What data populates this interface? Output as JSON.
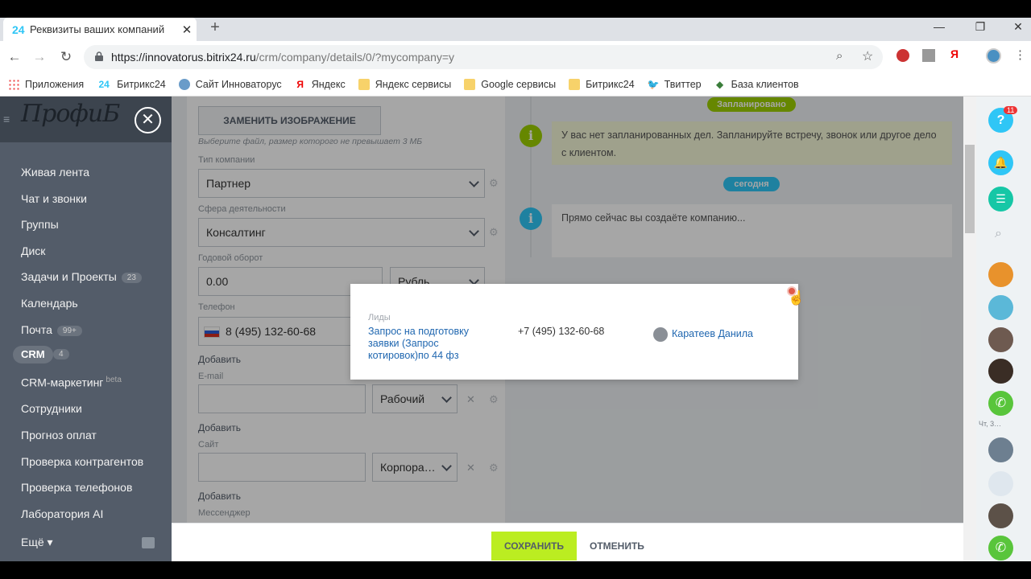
{
  "browser": {
    "tab_title": "Реквизиты ваших компаний",
    "tab_favicon": "24",
    "url_host": "https://innovatorus.bitrix24.ru",
    "url_path": "/crm/company/details/0/?mycompany=y",
    "bookmarks": [
      {
        "label": "Приложения",
        "icon": "apps-grid-icon"
      },
      {
        "label": "Битрикс24",
        "icon": "bitrix24-icon"
      },
      {
        "label": "Сайт Инноваторус",
        "icon": "globe-icon"
      },
      {
        "label": "Яндекс",
        "icon": "yandex-icon"
      },
      {
        "label": "Яндекс сервисы",
        "icon": "folder-icon"
      },
      {
        "label": "Google сервисы",
        "icon": "folder-icon"
      },
      {
        "label": "Битрикс24",
        "icon": "folder-icon"
      },
      {
        "label": "Твиттер",
        "icon": "twitter-icon"
      },
      {
        "label": "База клиентов",
        "icon": "bookmark-icon"
      }
    ]
  },
  "sidebar": {
    "logo": "ПрофиБ",
    "items": [
      {
        "label": "Живая лента"
      },
      {
        "label": "Чат и звонки"
      },
      {
        "label": "Группы"
      },
      {
        "label": "Диск"
      },
      {
        "label": "Задачи и Проекты",
        "count": "23"
      },
      {
        "label": "Календарь"
      },
      {
        "label": "Почта",
        "count": "99+"
      },
      {
        "label": "CRM",
        "count": "4"
      },
      {
        "label": "CRM-маркетинг",
        "sup": "beta"
      },
      {
        "label": "Сотрудники"
      },
      {
        "label": "Прогноз оплат"
      },
      {
        "label": "Проверка контрагентов"
      },
      {
        "label": "Проверка телефонов"
      },
      {
        "label": "Лаборатория AI"
      },
      {
        "label": "Ещё"
      }
    ]
  },
  "form": {
    "replace_image_button": "ЗАМЕНИТЬ ИЗОБРАЖЕНИЕ",
    "image_hint": "Выберите файл, размер которого не превышает 3 МБ",
    "company_type_label": "Тип компании",
    "company_type_value": "Партнер",
    "industry_label": "Сфера деятельности",
    "industry_value": "Консалтинг",
    "revenue_label": "Годовой оборот",
    "revenue_value": "0.00",
    "currency_value": "Рубль",
    "phone_label": "Телефон",
    "phone_value": "8 (495) 132-60-68",
    "add_label": "Добавить",
    "email_label": "E-mail",
    "email_type": "Рабочий",
    "site_label": "Сайт",
    "site_type": "Корпора…",
    "messenger_label": "Мессенджер"
  },
  "timeline": {
    "planned_pill": "Запланировано",
    "planned_text": "У вас нет запланированных дел. Запланируйте встречу, звонок или другое дело с клиентом.",
    "today_pill": "сегодня",
    "creating_text": "Прямо сейчас вы создаёте компанию..."
  },
  "popup": {
    "section": "Лиды",
    "lead_title": "Запрос на подготовку заявки (Запрос котировок)по 44 фз",
    "phone": "+7 (495) 132-60-68",
    "responsible": "Каратеев Данила"
  },
  "footer": {
    "save": "СОХРАНИТЬ",
    "cancel": "ОТМЕНИТЬ"
  },
  "rightbar": {
    "help_badge": "11",
    "chat_time": "Чт, 3…"
  },
  "colors": {
    "accent_green": "#bbed21",
    "pill_planned": "#9dcf00",
    "pill_today": "#2fc6f6",
    "sidebar_bg": "#535c69",
    "link_blue": "#2067b0"
  }
}
